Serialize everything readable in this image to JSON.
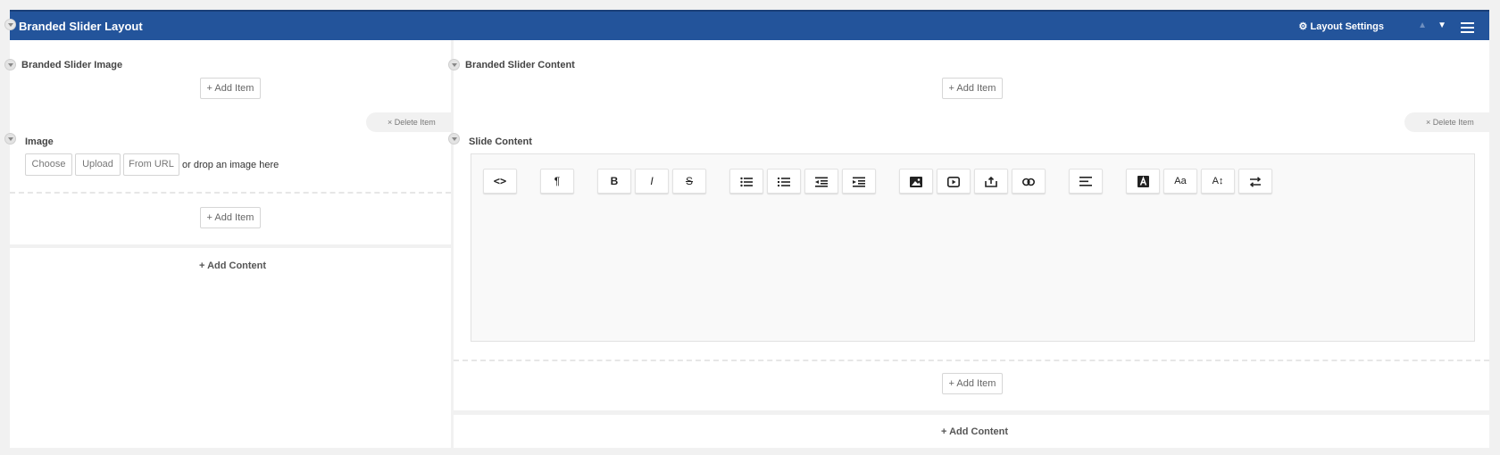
{
  "header": {
    "title": "Branded Slider Layout",
    "layout_settings": "Layout Settings",
    "arrow_up": "▲",
    "arrow_down": "▼"
  },
  "left": {
    "section_title": "Branded Slider Image",
    "add_item_top": "+ Add Item",
    "delete_item": "× Delete Item",
    "field_label": "Image",
    "choose": "Choose",
    "upload": "Upload",
    "from_url": "From URL",
    "drop_text": "or drop an image here",
    "add_item_bottom": "+ Add Item",
    "add_content": "+ Add Content"
  },
  "right": {
    "section_title": "Branded Slider Content",
    "add_item_top": "+ Add Item",
    "delete_item": "× Delete Item",
    "field_label": "Slide Content",
    "add_item_bottom": "+ Add Item",
    "add_content": "+ Add Content"
  },
  "toolbar": {
    "code": "<>",
    "paragraph": "¶",
    "bold": "B",
    "italic": "I",
    "strike": "S",
    "font_size": "Aa",
    "text_size": "A↕"
  },
  "colors": {
    "header": "#23549b",
    "background": "#f1f1f1"
  }
}
